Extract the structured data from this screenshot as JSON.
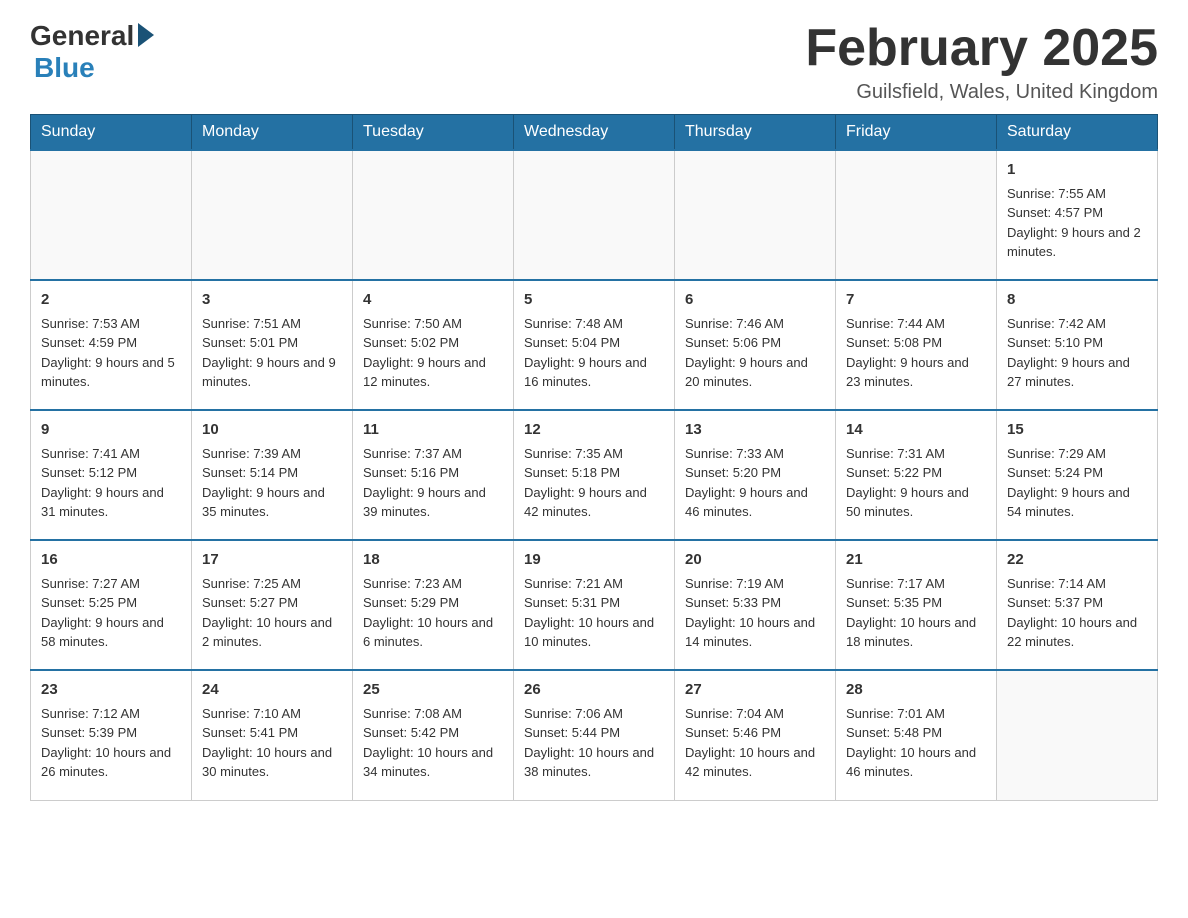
{
  "logo": {
    "general": "General",
    "blue": "Blue"
  },
  "title": "February 2025",
  "location": "Guilsfield, Wales, United Kingdom",
  "weekdays": [
    "Sunday",
    "Monday",
    "Tuesday",
    "Wednesday",
    "Thursday",
    "Friday",
    "Saturday"
  ],
  "weeks": [
    [
      {
        "day": "",
        "info": ""
      },
      {
        "day": "",
        "info": ""
      },
      {
        "day": "",
        "info": ""
      },
      {
        "day": "",
        "info": ""
      },
      {
        "day": "",
        "info": ""
      },
      {
        "day": "",
        "info": ""
      },
      {
        "day": "1",
        "info": "Sunrise: 7:55 AM\nSunset: 4:57 PM\nDaylight: 9 hours and 2 minutes."
      }
    ],
    [
      {
        "day": "2",
        "info": "Sunrise: 7:53 AM\nSunset: 4:59 PM\nDaylight: 9 hours and 5 minutes."
      },
      {
        "day": "3",
        "info": "Sunrise: 7:51 AM\nSunset: 5:01 PM\nDaylight: 9 hours and 9 minutes."
      },
      {
        "day": "4",
        "info": "Sunrise: 7:50 AM\nSunset: 5:02 PM\nDaylight: 9 hours and 12 minutes."
      },
      {
        "day": "5",
        "info": "Sunrise: 7:48 AM\nSunset: 5:04 PM\nDaylight: 9 hours and 16 minutes."
      },
      {
        "day": "6",
        "info": "Sunrise: 7:46 AM\nSunset: 5:06 PM\nDaylight: 9 hours and 20 minutes."
      },
      {
        "day": "7",
        "info": "Sunrise: 7:44 AM\nSunset: 5:08 PM\nDaylight: 9 hours and 23 minutes."
      },
      {
        "day": "8",
        "info": "Sunrise: 7:42 AM\nSunset: 5:10 PM\nDaylight: 9 hours and 27 minutes."
      }
    ],
    [
      {
        "day": "9",
        "info": "Sunrise: 7:41 AM\nSunset: 5:12 PM\nDaylight: 9 hours and 31 minutes."
      },
      {
        "day": "10",
        "info": "Sunrise: 7:39 AM\nSunset: 5:14 PM\nDaylight: 9 hours and 35 minutes."
      },
      {
        "day": "11",
        "info": "Sunrise: 7:37 AM\nSunset: 5:16 PM\nDaylight: 9 hours and 39 minutes."
      },
      {
        "day": "12",
        "info": "Sunrise: 7:35 AM\nSunset: 5:18 PM\nDaylight: 9 hours and 42 minutes."
      },
      {
        "day": "13",
        "info": "Sunrise: 7:33 AM\nSunset: 5:20 PM\nDaylight: 9 hours and 46 minutes."
      },
      {
        "day": "14",
        "info": "Sunrise: 7:31 AM\nSunset: 5:22 PM\nDaylight: 9 hours and 50 minutes."
      },
      {
        "day": "15",
        "info": "Sunrise: 7:29 AM\nSunset: 5:24 PM\nDaylight: 9 hours and 54 minutes."
      }
    ],
    [
      {
        "day": "16",
        "info": "Sunrise: 7:27 AM\nSunset: 5:25 PM\nDaylight: 9 hours and 58 minutes."
      },
      {
        "day": "17",
        "info": "Sunrise: 7:25 AM\nSunset: 5:27 PM\nDaylight: 10 hours and 2 minutes."
      },
      {
        "day": "18",
        "info": "Sunrise: 7:23 AM\nSunset: 5:29 PM\nDaylight: 10 hours and 6 minutes."
      },
      {
        "day": "19",
        "info": "Sunrise: 7:21 AM\nSunset: 5:31 PM\nDaylight: 10 hours and 10 minutes."
      },
      {
        "day": "20",
        "info": "Sunrise: 7:19 AM\nSunset: 5:33 PM\nDaylight: 10 hours and 14 minutes."
      },
      {
        "day": "21",
        "info": "Sunrise: 7:17 AM\nSunset: 5:35 PM\nDaylight: 10 hours and 18 minutes."
      },
      {
        "day": "22",
        "info": "Sunrise: 7:14 AM\nSunset: 5:37 PM\nDaylight: 10 hours and 22 minutes."
      }
    ],
    [
      {
        "day": "23",
        "info": "Sunrise: 7:12 AM\nSunset: 5:39 PM\nDaylight: 10 hours and 26 minutes."
      },
      {
        "day": "24",
        "info": "Sunrise: 7:10 AM\nSunset: 5:41 PM\nDaylight: 10 hours and 30 minutes."
      },
      {
        "day": "25",
        "info": "Sunrise: 7:08 AM\nSunset: 5:42 PM\nDaylight: 10 hours and 34 minutes."
      },
      {
        "day": "26",
        "info": "Sunrise: 7:06 AM\nSunset: 5:44 PM\nDaylight: 10 hours and 38 minutes."
      },
      {
        "day": "27",
        "info": "Sunrise: 7:04 AM\nSunset: 5:46 PM\nDaylight: 10 hours and 42 minutes."
      },
      {
        "day": "28",
        "info": "Sunrise: 7:01 AM\nSunset: 5:48 PM\nDaylight: 10 hours and 46 minutes."
      },
      {
        "day": "",
        "info": ""
      }
    ]
  ]
}
